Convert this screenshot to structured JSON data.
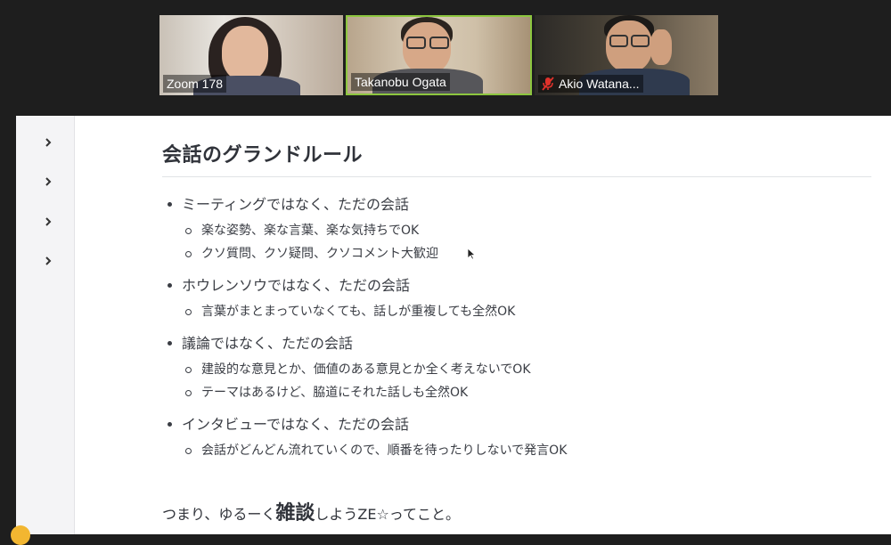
{
  "participants": [
    {
      "name": "Zoom 178",
      "muted": false,
      "active_speaker": false
    },
    {
      "name": "Takanobu Ogata",
      "muted": false,
      "active_speaker": true
    },
    {
      "name": "Akio Watana...",
      "muted": true,
      "active_speaker": false
    }
  ],
  "colors": {
    "active_speaker_border": "#8dc63f",
    "mute_icon": "#e0322b",
    "text": "#3a3d44",
    "user_dot": "#f2b631"
  },
  "icons": {
    "sidebar": "chevron-right-icon",
    "mute": "microphone-muted-icon",
    "pointer": "mouse-cursor-icon"
  },
  "document": {
    "title": "会話のグランドルール",
    "sections": [
      {
        "text": "ミーティングではなく、ただの会話",
        "items": [
          "楽な姿勢、楽な言葉、楽な気持ちでOK",
          "クソ質問、クソ疑問、クソコメント大歓迎"
        ]
      },
      {
        "text": "ホウレンソウではなく、ただの会話",
        "items": [
          "言葉がまとまっていなくても、話しが重複しても全然OK"
        ]
      },
      {
        "text": "議論ではなく、ただの会話",
        "items": [
          "建設的な意見とか、価値のある意見とか全く考えないでOK",
          "テーマはあるけど、脇道にそれた話しも全然OK"
        ]
      },
      {
        "text": "インタビューではなく、ただの会話",
        "items": [
          "会話がどんどん流れていくので、順番を待ったりしないで発言OK"
        ]
      }
    ],
    "summary": {
      "before": "つまり、ゆるーく",
      "emphasis": "雑談",
      "after": "しようZE☆ってこと。"
    }
  }
}
